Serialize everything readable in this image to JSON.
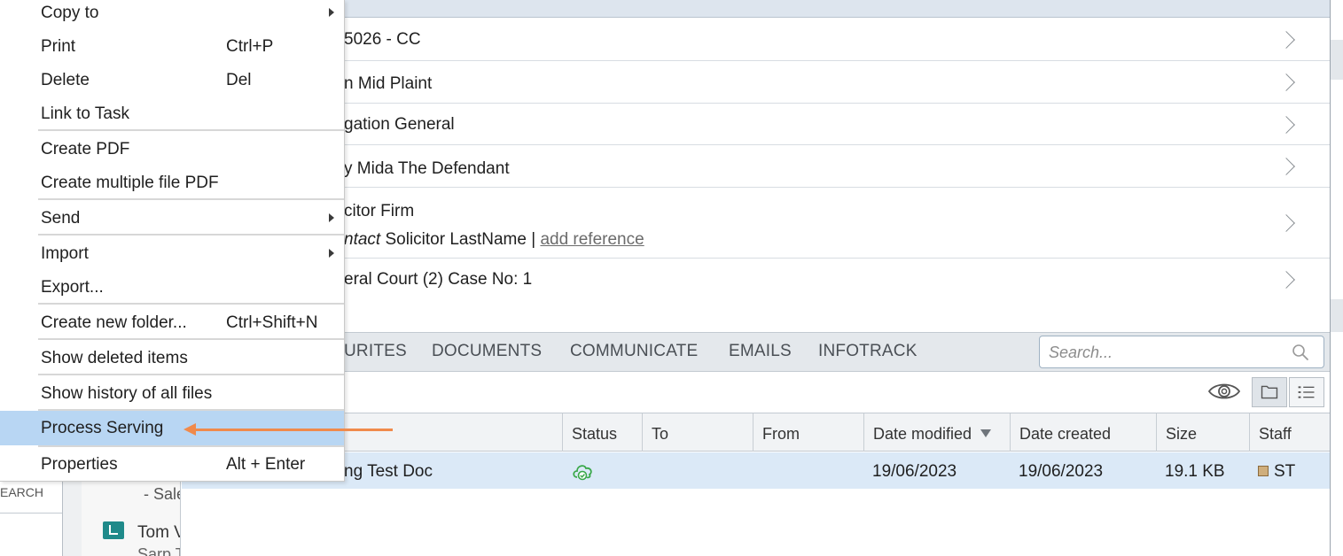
{
  "details": {
    "rows": [
      {
        "text": "5026 - CC"
      },
      {
        "text": "n Mid Plaint"
      },
      {
        "text": "gation General"
      },
      {
        "text": "y Mida The Defendant"
      },
      {
        "line1": "citor Firm",
        "line2_italic": "ntact",
        "line2_name": " Solicitor LastName | ",
        "line2_link": "add reference"
      },
      {
        "text": "eral Court (2) Case No: 1"
      }
    ]
  },
  "tabs": [
    {
      "label": "URITES"
    },
    {
      "label": "DOCUMENTS"
    },
    {
      "label": "COMMUNICATE"
    },
    {
      "label": "EMAILS"
    },
    {
      "label": "INFOTRACK"
    }
  ],
  "search": {
    "placeholder": "Search..."
  },
  "table": {
    "columns": [
      "Status",
      "To",
      "From",
      "Date modified",
      "Date created",
      "Size",
      "Staff"
    ],
    "row": {
      "name": "ng Test Doc",
      "to": "",
      "from": "",
      "date_modified": "19/06/2023",
      "date_created": "19/06/2023",
      "size": "19.1 KB",
      "staff": "ST"
    }
  },
  "left_panel": {
    "search_fragment": "EARCH",
    "item1_fragment": "- Sale",
    "item2_fragment": "Tom V",
    "item2_sub_fragment": "Sarp T"
  },
  "context_menu": {
    "items": [
      {
        "label": "Copy to",
        "shortcut": "",
        "submenu": true
      },
      {
        "label": "Print",
        "shortcut": "Ctrl+P"
      },
      {
        "label": "Delete",
        "shortcut": "Del"
      },
      {
        "label": "Link to Task",
        "shortcut": ""
      },
      {
        "label": "Create PDF",
        "shortcut": ""
      },
      {
        "label": "Create multiple file PDF",
        "shortcut": ""
      },
      {
        "label": "Send",
        "shortcut": "",
        "submenu": true
      },
      {
        "label": "Import",
        "shortcut": "",
        "submenu": true
      },
      {
        "label": "Export...",
        "shortcut": ""
      },
      {
        "label": "Create new folder...",
        "shortcut": "Ctrl+Shift+N"
      },
      {
        "label": "Show deleted items",
        "shortcut": ""
      },
      {
        "label": "Show history of all files",
        "shortcut": ""
      },
      {
        "label": "Process Serving",
        "shortcut": "",
        "highlighted": true
      },
      {
        "label": "Properties",
        "shortcut": "Alt + Enter"
      }
    ]
  },
  "colors": {
    "menu_highlight": "#b8d6f3",
    "annotation_arrow": "#f08a4b",
    "selected_row": "#dbe9f7",
    "status_icon": "#3aa84a",
    "tab_bar": "#e4e8ec"
  },
  "icons": {
    "status": "cloud-check-icon",
    "search": "search-icon",
    "preview": "eye-icon",
    "folder_view": "folder-icon",
    "list_view": "list-icon",
    "submenu": "chevron-right-icon",
    "row_nav": "chevron-right-icon"
  }
}
